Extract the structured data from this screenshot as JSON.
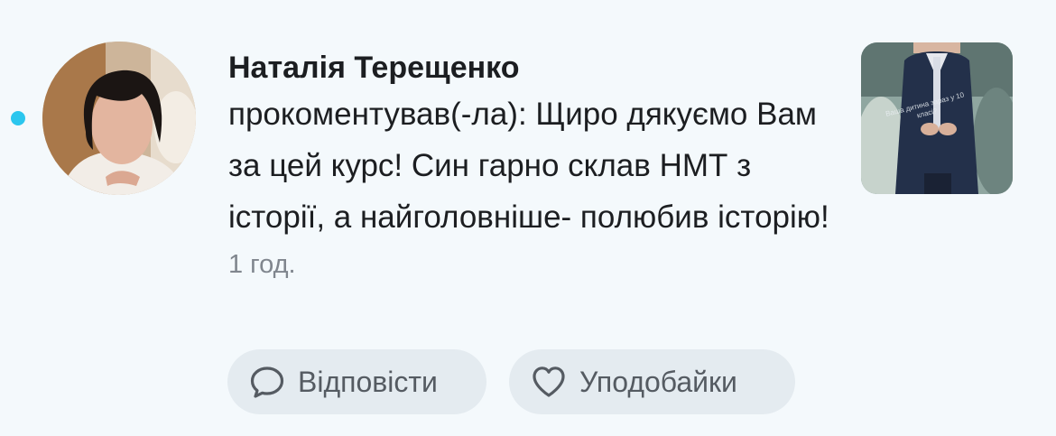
{
  "notification": {
    "author": "Наталія Терещенко",
    "message": "прокоментував(-ла): Щиро дякуємо Вам за цей курс! Син гарно склав НМТ з історії, а найголовніше- полюбив історію!",
    "time": "1 год.",
    "thumbnail_caption": "Ваша дитина зараз у 10 класі?",
    "unread": true,
    "colors": {
      "background": "#f4f9fc",
      "unread_dot": "#2bc6ee",
      "button_bg": "#e4ebf0",
      "muted_text": "#80868e"
    }
  },
  "actions": {
    "reply_label": "Відповісти",
    "reply_icon": "speech-bubble-icon",
    "like_label": "Уподобайки",
    "like_icon": "heart-icon"
  }
}
